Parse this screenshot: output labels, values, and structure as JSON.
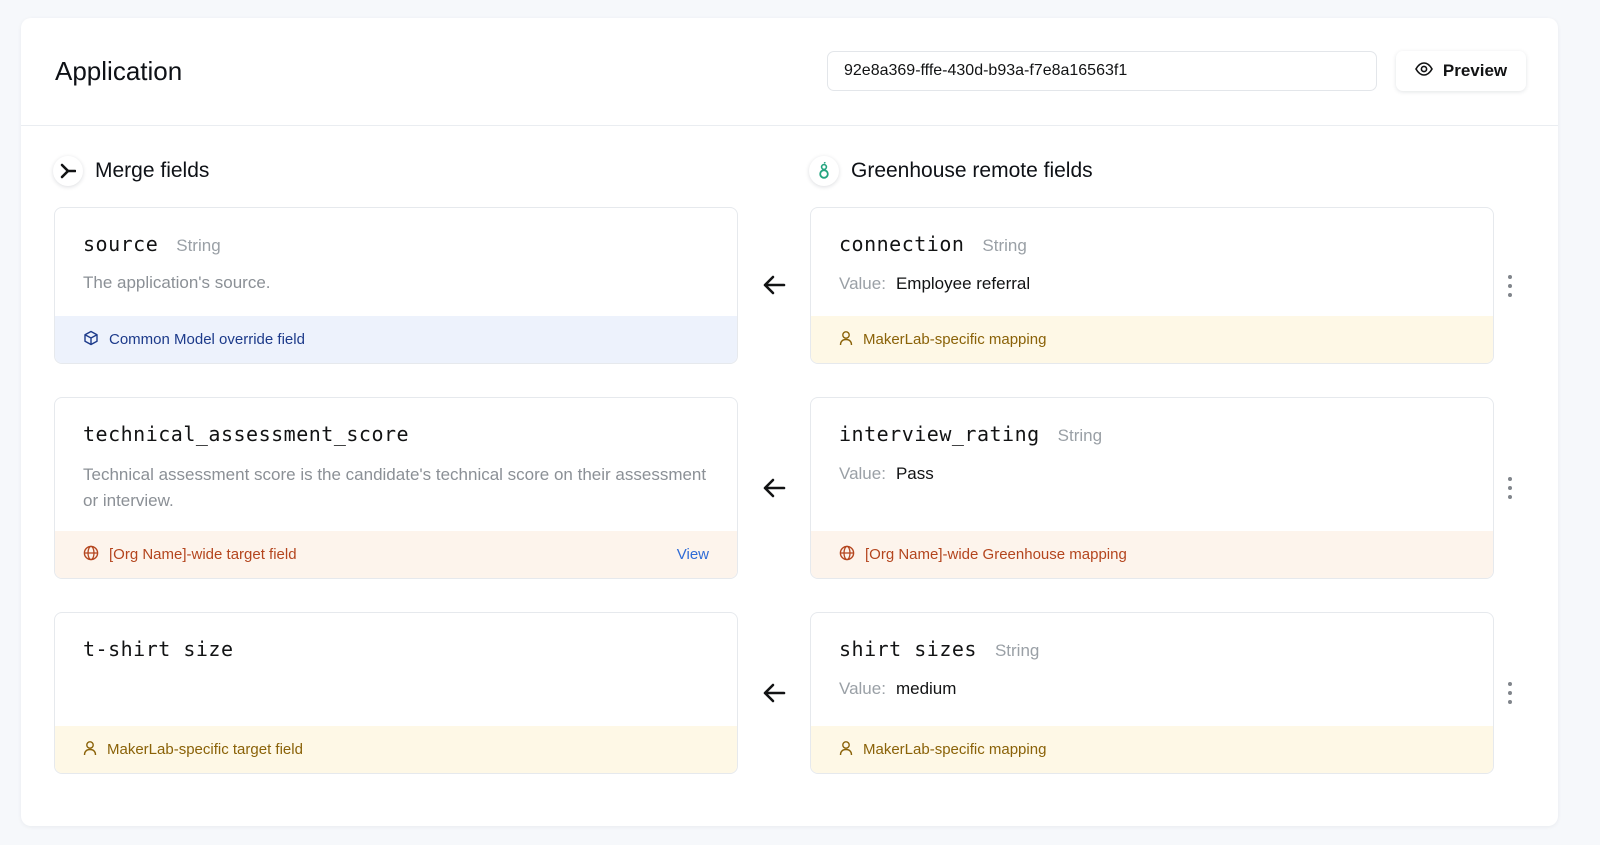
{
  "header": {
    "title": "Application",
    "id_value": "92e8a369-fffe-430d-b93a-f7e8a16563f1",
    "preview_label": "Preview"
  },
  "left_section": {
    "title": "Merge fields"
  },
  "right_section": {
    "title": "Greenhouse remote fields"
  },
  "rows": [
    {
      "merge": {
        "name": "source",
        "type": "String",
        "description": "The application's source.",
        "footer": "Common Model override field",
        "footer_style": "blue",
        "footer_icon": "cube-icon"
      },
      "remote": {
        "name": "connection",
        "type": "String",
        "value_label": "Value:",
        "value": "Employee referral",
        "footer": "MakerLab-specific mapping",
        "footer_style": "amber",
        "footer_icon": "user-icon"
      }
    },
    {
      "merge": {
        "name": "technical_assessment_score",
        "description": "Technical assessment score is the candidate's technical score on their assessment or interview.",
        "footer": "[Org Name]-wide target field",
        "footer_style": "orange",
        "footer_icon": "globe-icon",
        "view_label": "View"
      },
      "remote": {
        "name": "interview_rating",
        "type": "String",
        "value_label": "Value:",
        "value": "Pass",
        "footer": "[Org Name]-wide Greenhouse mapping",
        "footer_style": "orange",
        "footer_icon": "globe-icon"
      }
    },
    {
      "merge": {
        "name": "t-shirt size",
        "footer": "MakerLab-specific target field",
        "footer_style": "amber",
        "footer_icon": "user-icon"
      },
      "remote": {
        "name": "shirt sizes",
        "type": "String",
        "value_label": "Value:",
        "value": "medium",
        "footer": "MakerLab-specific mapping",
        "footer_style": "amber",
        "footer_icon": "user-icon"
      }
    }
  ],
  "colors": {
    "blue_footer_bg": "#edf2fc",
    "amber_footer_bg": "#fef8e6",
    "orange_footer_bg": "#fdf4ec",
    "link": "#2f6bd6",
    "greenhouse_green": "#24a47f"
  }
}
